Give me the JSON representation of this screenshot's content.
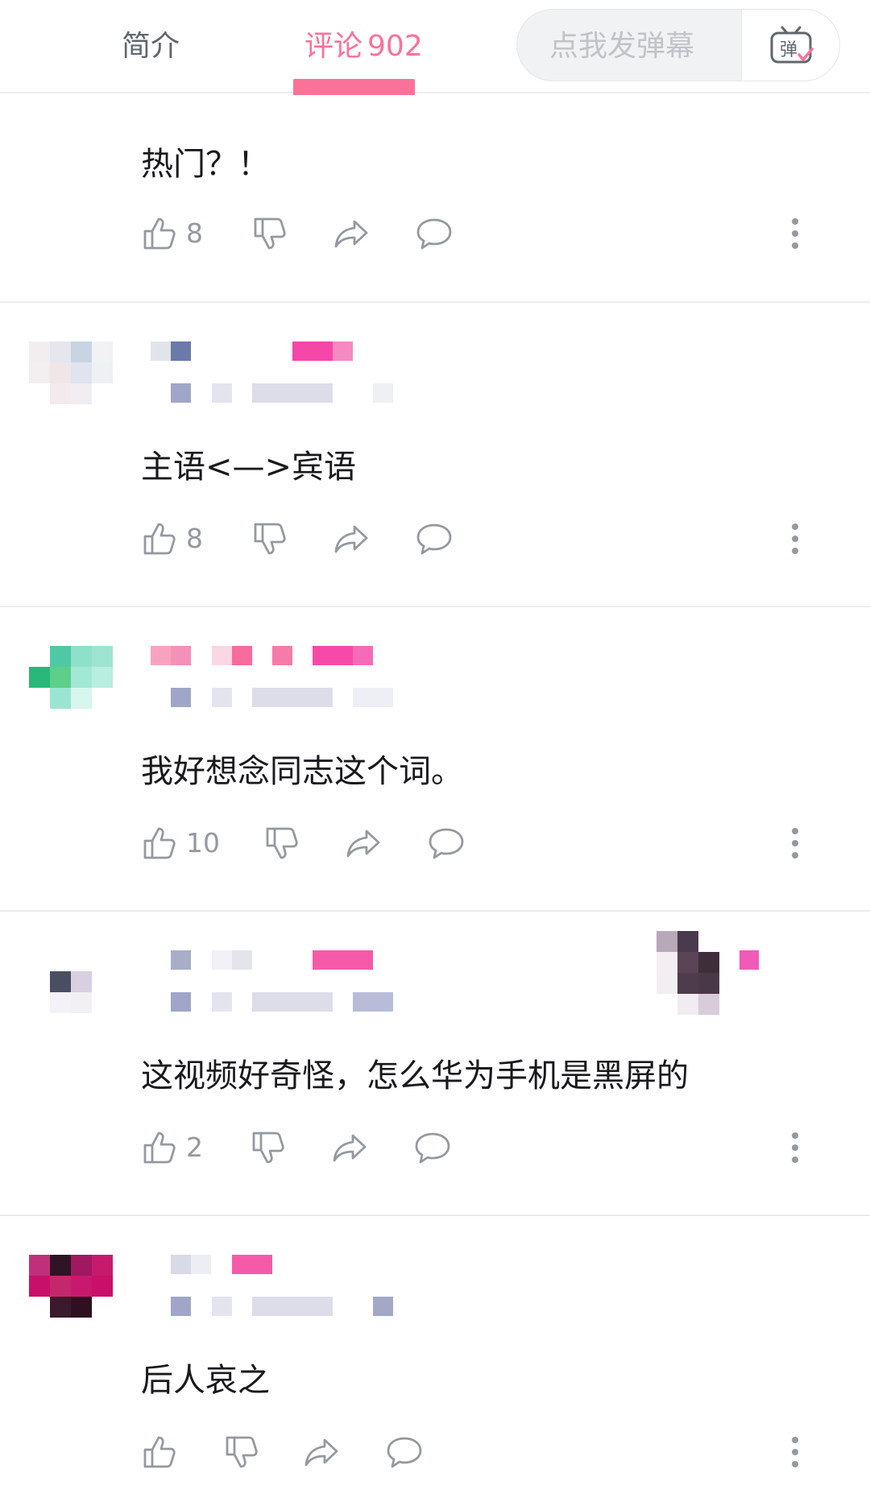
{
  "tabs": {
    "intro_label": "简介",
    "comments_label": "评论",
    "comments_count": "902"
  },
  "danmaku": {
    "placeholder": "点我发弹幕",
    "button_label": "弹"
  },
  "colors": {
    "accent": "#fb7299",
    "icon": "#9499a0",
    "text": "#18191c"
  },
  "comments": [
    {
      "text": "热门？！",
      "likes": "8"
    },
    {
      "text": "主语<—>宾语",
      "likes": "8"
    },
    {
      "text": "我好想念同志这个词。",
      "likes": "10"
    },
    {
      "text": "这视频好奇怪，怎么华为手机是黑屏的",
      "likes": "2"
    },
    {
      "text": "后人哀之",
      "likes": ""
    }
  ],
  "icons": [
    "thumbs-up-icon",
    "thumbs-down-icon",
    "share-icon",
    "reply-bubble-icon",
    "more-vertical-icon",
    "danmaku-tv-icon"
  ]
}
